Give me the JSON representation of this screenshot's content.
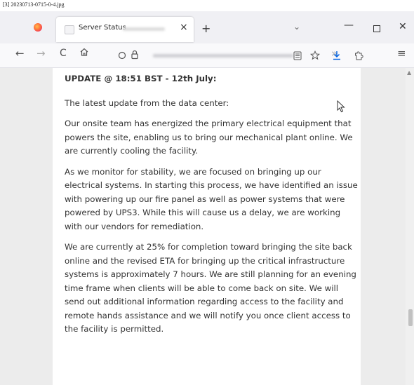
{
  "caption": "[3] 20230713-0715-0-4.jpg",
  "browser": {
    "tab_title": "Server Status",
    "tab_close": "×",
    "new_tab": "+",
    "tab_list": "⌄",
    "minimize": "—",
    "close": "✕",
    "back": "←",
    "forward": "→",
    "reload": "C",
    "overflow": "»",
    "menu": "≡"
  },
  "content": {
    "heading": "UPDATE @ 18:51 BST - 12th July:",
    "paragraphs": [
      "The latest update from the data center:",
      "Our onsite team has energized the primary electrical equipment that powers the site, enabling us to bring our mechanical plant online. We are currently cooling the facility.",
      "As we monitor for stability, we are focused on bringing up our electrical systems. In starting this process, we have identified an issue with powering up our fire panel as well as power systems that were powered by UPS3. While this will cause us a delay, we are working with our vendors for remediation.",
      "We are currently at 25% for completion toward bringing the site back online and the revised ETA for bringing up the critical infrastructure systems is approximately 7 hours. We are still planning for an evening time frame when clients will be able to come back on site. We will send out additional information regarding access to the facility and remote hands assistance and we will notify you once client access to the facility is permitted."
    ]
  },
  "colors": {
    "accent_download": "#0061e0",
    "page_background": "#ececec"
  }
}
